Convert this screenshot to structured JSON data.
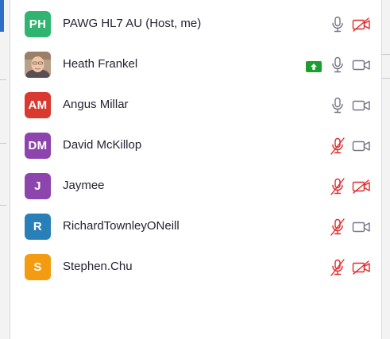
{
  "participants": [
    {
      "initials": "PH",
      "name": "PAWG HL7 AU (Host, me)",
      "avatar_color": "#2fb56f",
      "photo": false,
      "sharing": false,
      "mic_muted": false,
      "video_off": true
    },
    {
      "initials": "",
      "name": "Heath Frankel",
      "avatar_color": "#8a6a5a",
      "photo": true,
      "sharing": true,
      "mic_muted": false,
      "video_off": false
    },
    {
      "initials": "AM",
      "name": "Angus Millar",
      "avatar_color": "#d9392e",
      "photo": false,
      "sharing": false,
      "mic_muted": false,
      "video_off": false
    },
    {
      "initials": "DM",
      "name": "David McKillop",
      "avatar_color": "#8e44ad",
      "photo": false,
      "sharing": false,
      "mic_muted": true,
      "video_off": false
    },
    {
      "initials": "J",
      "name": "Jaymee",
      "avatar_color": "#8e44ad",
      "photo": false,
      "sharing": false,
      "mic_muted": true,
      "video_off": true
    },
    {
      "initials": "R",
      "name": "RichardTownleyONeill",
      "avatar_color": "#2980b9",
      "photo": false,
      "sharing": false,
      "mic_muted": true,
      "video_off": false
    },
    {
      "initials": "S",
      "name": "Stephen.Chu",
      "avatar_color": "#f39c12",
      "photo": false,
      "sharing": false,
      "mic_muted": true,
      "video_off": true
    }
  ],
  "colors": {
    "muted_red": "#e02828",
    "icon_gray": "#747487",
    "share_green": "#1a9f2e"
  },
  "icons": {
    "mic": "microphone-icon",
    "mic_muted": "microphone-muted-icon",
    "cam": "video-camera-icon",
    "cam_off": "video-camera-off-icon",
    "share": "share-screen-icon"
  }
}
